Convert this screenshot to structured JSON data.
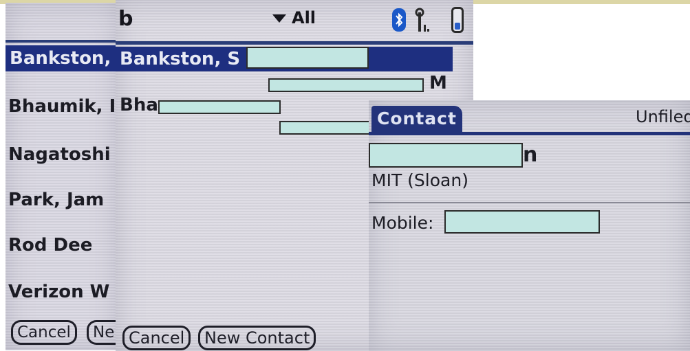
{
  "screen_list": {
    "rows": [
      "Bankston,",
      "Bhaumik, I",
      "Nagatoshi",
      "Park, Jam",
      "Rod Dee",
      "Verizon W"
    ],
    "buttons": {
      "cancel": "Cancel",
      "new_partial": "Ne"
    }
  },
  "screen_search": {
    "query": "b",
    "category": "All",
    "selected_row": "Bankston, S",
    "row2": "Bha",
    "phone_type_1": "M",
    "buttons": {
      "cancel": "Cancel",
      "new_contact": "New Contact"
    },
    "icons": [
      "bluetooth-icon",
      "signal-icon",
      "battery-icon",
      "dropdown-triangle-icon"
    ]
  },
  "screen_contact": {
    "tab_title": "Contact",
    "category": "Unfiled",
    "name_tail": "n",
    "company": "MIT (Sloan)",
    "mobile_label": "Mobile:"
  },
  "colors": {
    "highlight": "#1e2f80",
    "redaction_fill": "#c2e6e2",
    "screen_bg": "#d9d7e2",
    "top_strip": "#dcd6a6"
  }
}
